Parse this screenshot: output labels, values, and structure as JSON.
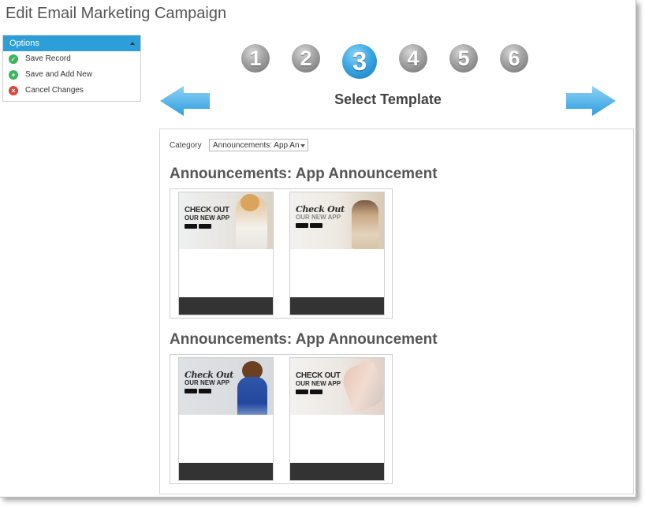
{
  "page": {
    "title": "Edit Email Marketing Campaign"
  },
  "options": {
    "header": "Options",
    "items": [
      {
        "label": "Save Record",
        "icon": "check-circle-icon"
      },
      {
        "label": "Save and Add New",
        "icon": "plus-circle-icon"
      },
      {
        "label": "Cancel Changes",
        "icon": "x-circle-icon"
      }
    ]
  },
  "wizard": {
    "steps": [
      "1",
      "2",
      "3",
      "4",
      "5",
      "6"
    ],
    "active_step": "3",
    "step_title": "Select Template",
    "prev_icon": "left-arrow-icon",
    "next_icon": "right-arrow-icon"
  },
  "filter": {
    "category_label": "Category",
    "category_value": "Announcements: App An"
  },
  "groups": [
    {
      "title": "Announcements: App Announcement",
      "templates": [
        {
          "line1": "CHECK OUT",
          "line2": "OUR NEW APP"
        },
        {
          "line1": "Check Out",
          "line2": "OUR NEW APP"
        }
      ]
    },
    {
      "title": "Announcements: App Announcement",
      "templates": [
        {
          "line1": "Check Out",
          "line2": "OUR NEW APP"
        },
        {
          "line1": "CHECK OUT",
          "line2": "OUR NEW APP"
        }
      ]
    }
  ],
  "colors": {
    "accent": "#2d9fd8",
    "active_step": "#3aa8e3",
    "footer": "#333333"
  }
}
